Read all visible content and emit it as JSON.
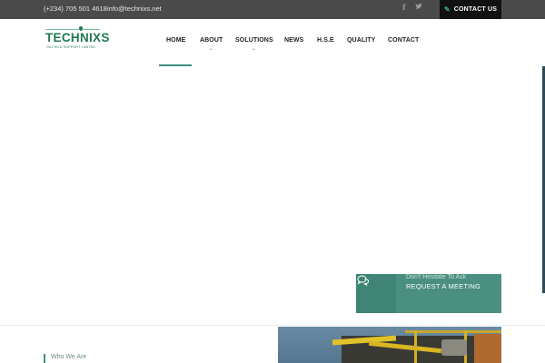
{
  "topbar": {
    "phone": "(+234) 705 501 4618",
    "email": "info@technixs.net",
    "social": [
      {
        "icon": "facebook-icon",
        "glyph": "f"
      },
      {
        "icon": "twitter-icon",
        "glyph": "🐦"
      }
    ],
    "contact_button": "CONTACT US",
    "contact_icon": "edit-icon"
  },
  "logo": {
    "brand": "TECHNIXS",
    "tagline": "OILFIELD SUPPORT LIMITED"
  },
  "nav": {
    "items": [
      {
        "label": "HOME",
        "active": true,
        "dropdown": false
      },
      {
        "label": "ABOUT",
        "active": false,
        "dropdown": true
      },
      {
        "label": "SOLUTIONS",
        "active": false,
        "dropdown": true
      },
      {
        "label": "NEWS",
        "active": false,
        "dropdown": false
      },
      {
        "label": "H.S.E",
        "active": false,
        "dropdown": false
      },
      {
        "label": "QUALITY",
        "active": false,
        "dropdown": false
      },
      {
        "label": "CONTACT",
        "active": false,
        "dropdown": false
      }
    ],
    "accent_color": "#3c8f7f"
  },
  "request": {
    "subtitle": "Don't Hesitate To Ask",
    "title": "REQUEST A MEETING",
    "icon": "chat-bubbles-icon"
  },
  "section": {
    "label": "Who We Are"
  },
  "colors": {
    "topbar_bg": "#4a4a4a",
    "brand_green": "#1f7a52",
    "cta_teal": "#4a8f80"
  }
}
